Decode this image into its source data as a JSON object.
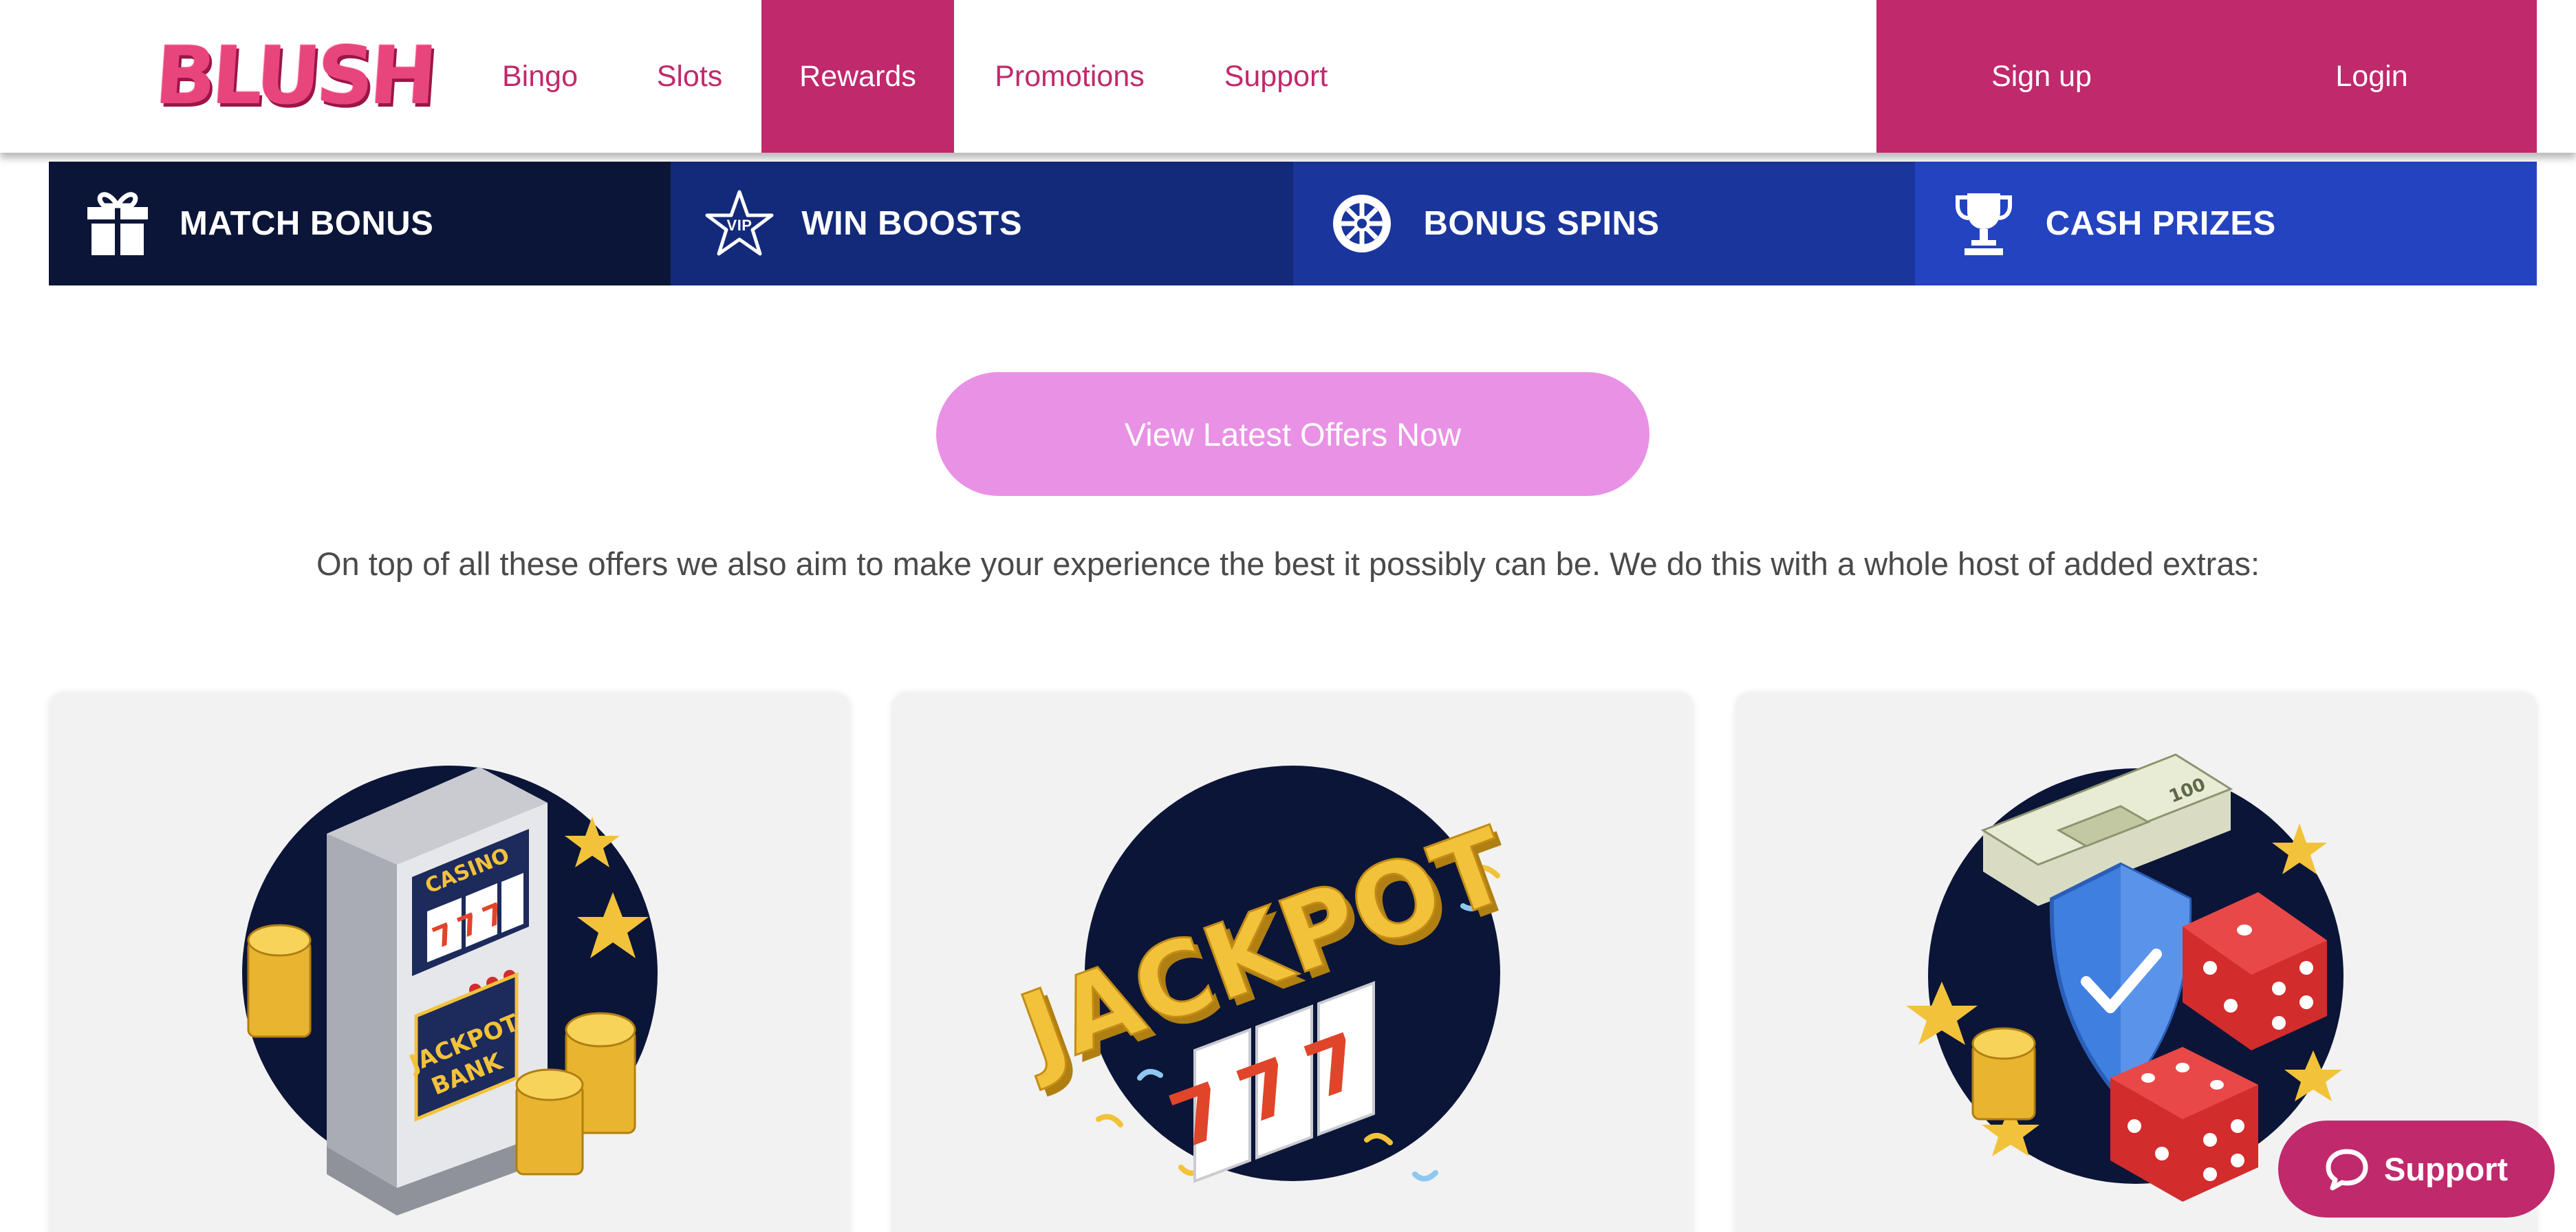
{
  "brand": {
    "name": "BLUSH"
  },
  "nav": {
    "items": [
      {
        "label": "Bingo",
        "active": false
      },
      {
        "label": "Slots",
        "active": false
      },
      {
        "label": "Rewards",
        "active": true
      },
      {
        "label": "Promotions",
        "active": false
      },
      {
        "label": "Support",
        "active": false
      }
    ],
    "signup_label": "Sign up",
    "login_label": "Login"
  },
  "features": [
    {
      "label": "MATCH BONUS",
      "icon": "gift-icon"
    },
    {
      "label": "WIN BOOSTS",
      "icon": "vip-star-icon",
      "icon_text": "VIP"
    },
    {
      "label": "BONUS SPINS",
      "icon": "wheel-icon"
    },
    {
      "label": "CASH PRIZES",
      "icon": "trophy-icon"
    }
  ],
  "cta": {
    "label": "View Latest Offers Now"
  },
  "intro_text": "On top of all these offers we also aim to make your experience the best it possibly can be. We do this with a whole host of added extras:",
  "cards": [
    {
      "image": "slot-machine-illustration",
      "screen_text": "CASINO",
      "reels": "777",
      "panel_text_1": "JACKPOT",
      "panel_text_2": "BANK"
    },
    {
      "image": "jackpot-illustration",
      "headline": "JACKPOT",
      "reels": "777"
    },
    {
      "image": "security-dice-illustration",
      "note_value": "100"
    }
  ],
  "support_button": {
    "label": "Support",
    "icon": "chat-bubble-icon"
  },
  "colors": {
    "brand_pink": "#c0296c",
    "cta_pink": "#e991e5",
    "navy_dark": "#0b1538",
    "blue_1": "#13297a",
    "blue_2": "#1a359c",
    "blue_3": "#2443c0",
    "card_bg": "#f2f2f2",
    "gold": "#f2c23a",
    "dice_red": "#d22c2c",
    "shield_blue": "#3f7fe0"
  }
}
